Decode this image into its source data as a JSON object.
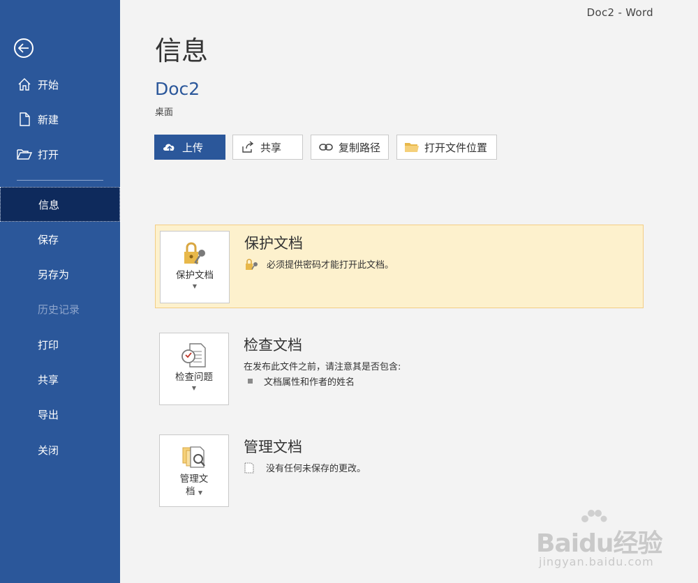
{
  "window": {
    "title": "Doc2  -  Word"
  },
  "sidebar": {
    "items": [
      {
        "label": "开始"
      },
      {
        "label": "新建"
      },
      {
        "label": "打开"
      },
      {
        "label": "信息"
      },
      {
        "label": "保存"
      },
      {
        "label": "另存为"
      },
      {
        "label": "历史记录"
      },
      {
        "label": "打印"
      },
      {
        "label": "共享"
      },
      {
        "label": "导出"
      },
      {
        "label": "关闭"
      }
    ]
  },
  "main": {
    "title": "信息",
    "doc_name": "Doc2",
    "doc_location": "桌面",
    "buttons": {
      "upload": "上传",
      "share": "共享",
      "copy_path": "复制路径",
      "open_location": "打开文件位置"
    },
    "sections": {
      "protect": {
        "tile_label": "保护文档",
        "title": "保护文档",
        "desc": "必须提供密码才能打开此文档。"
      },
      "inspect": {
        "tile_label": "检查问题",
        "title": "检查文档",
        "desc": "在发布此文件之前，请注意其是否包含:",
        "bullet": "文档属性和作者的姓名"
      },
      "manage": {
        "tile_label_1": "管理文",
        "tile_label_2": "档",
        "title": "管理文档",
        "desc": "没有任何未保存的更改。"
      }
    }
  },
  "watermark": {
    "logo": "Baidu经验",
    "site": "jingyan.baidu.com"
  },
  "colors": {
    "sidebar": "#2b579a",
    "active": "#0e2a5c",
    "highlight": "#fdf1cd",
    "accent": "#2b579a"
  }
}
